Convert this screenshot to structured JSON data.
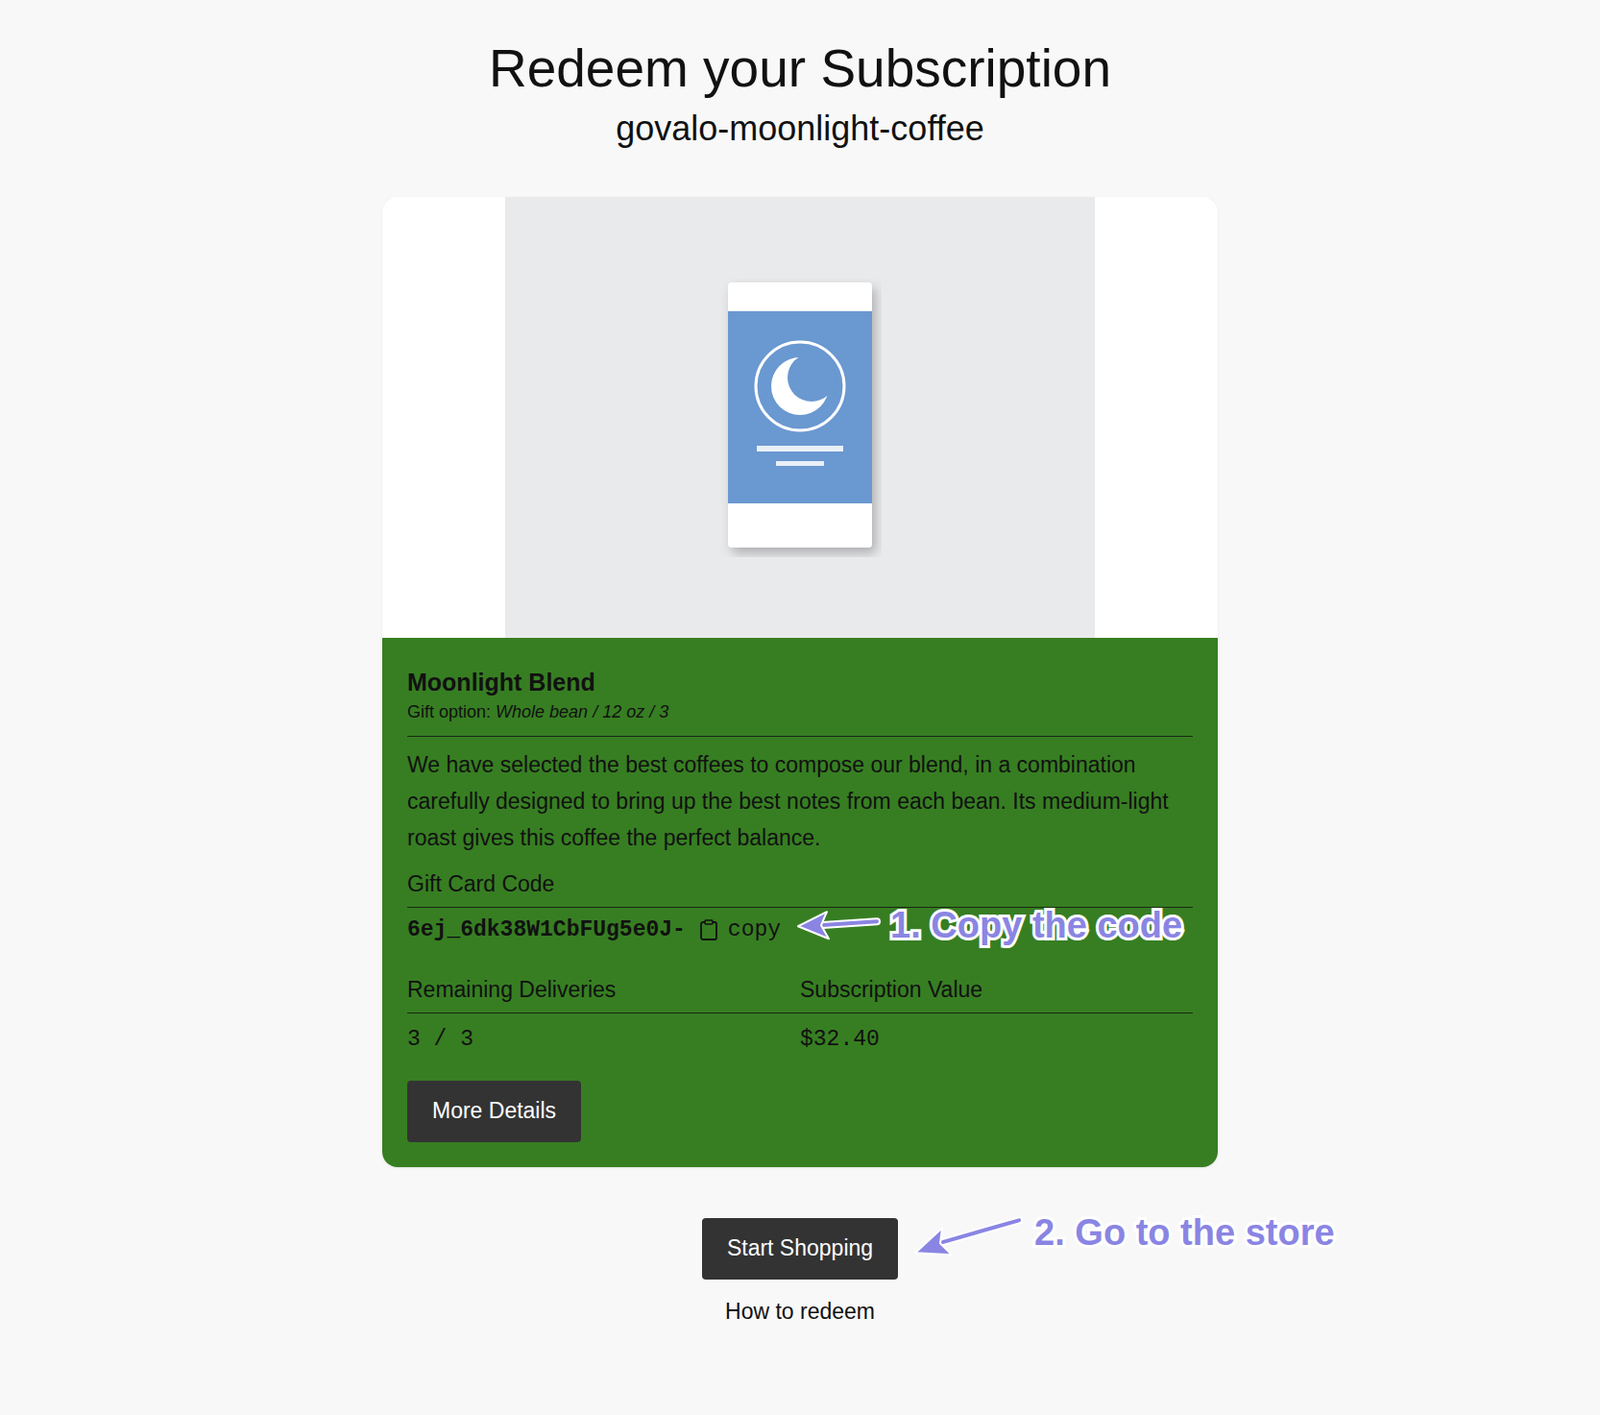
{
  "page": {
    "title": "Redeem your Subscription",
    "subtitle": "govalo-moonlight-coffee"
  },
  "product": {
    "name": "Moonlight Blend",
    "option_label": "Gift option:",
    "option_value": "Whole bean / 12 oz / 3",
    "description": "We have selected the best coffees to compose our blend, in a combination carefully designed to bring up the best notes from each bean. Its medium-light roast gives this coffee the perfect balance."
  },
  "gift_card": {
    "label": "Gift Card Code",
    "code": "6ej_6dk38W1CbFUg5e0J-",
    "copy_label": "copy"
  },
  "stats": [
    {
      "label": "Remaining Deliveries",
      "value": "3 / 3"
    },
    {
      "label": "Subscription Value",
      "value": "$32.40"
    }
  ],
  "buttons": {
    "details": "More Details",
    "shop": "Start Shopping",
    "help": "How to redeem"
  },
  "annotations": [
    {
      "text": "1. Copy the code"
    },
    {
      "text": "2. Go to the store"
    }
  ]
}
